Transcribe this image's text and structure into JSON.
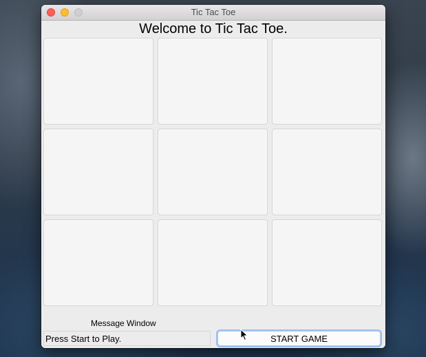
{
  "window": {
    "title": "Tic Tac Toe"
  },
  "header": {
    "welcome": "Welcome to Tic Tac Toe."
  },
  "board": {
    "cells": [
      "",
      "",
      "",
      "",
      "",
      "",
      "",
      "",
      ""
    ]
  },
  "message": {
    "label": "Message Window",
    "status": "Press Start to Play."
  },
  "controls": {
    "start_label": "START GAME"
  },
  "icons": {
    "close": "close-icon",
    "minimize": "minimize-icon",
    "maximize": "maximize-icon",
    "cursor": "mouse-pointer-icon"
  },
  "colors": {
    "close": "#fe5f57",
    "minimize": "#febc2e",
    "focus": "#9cbff0"
  }
}
